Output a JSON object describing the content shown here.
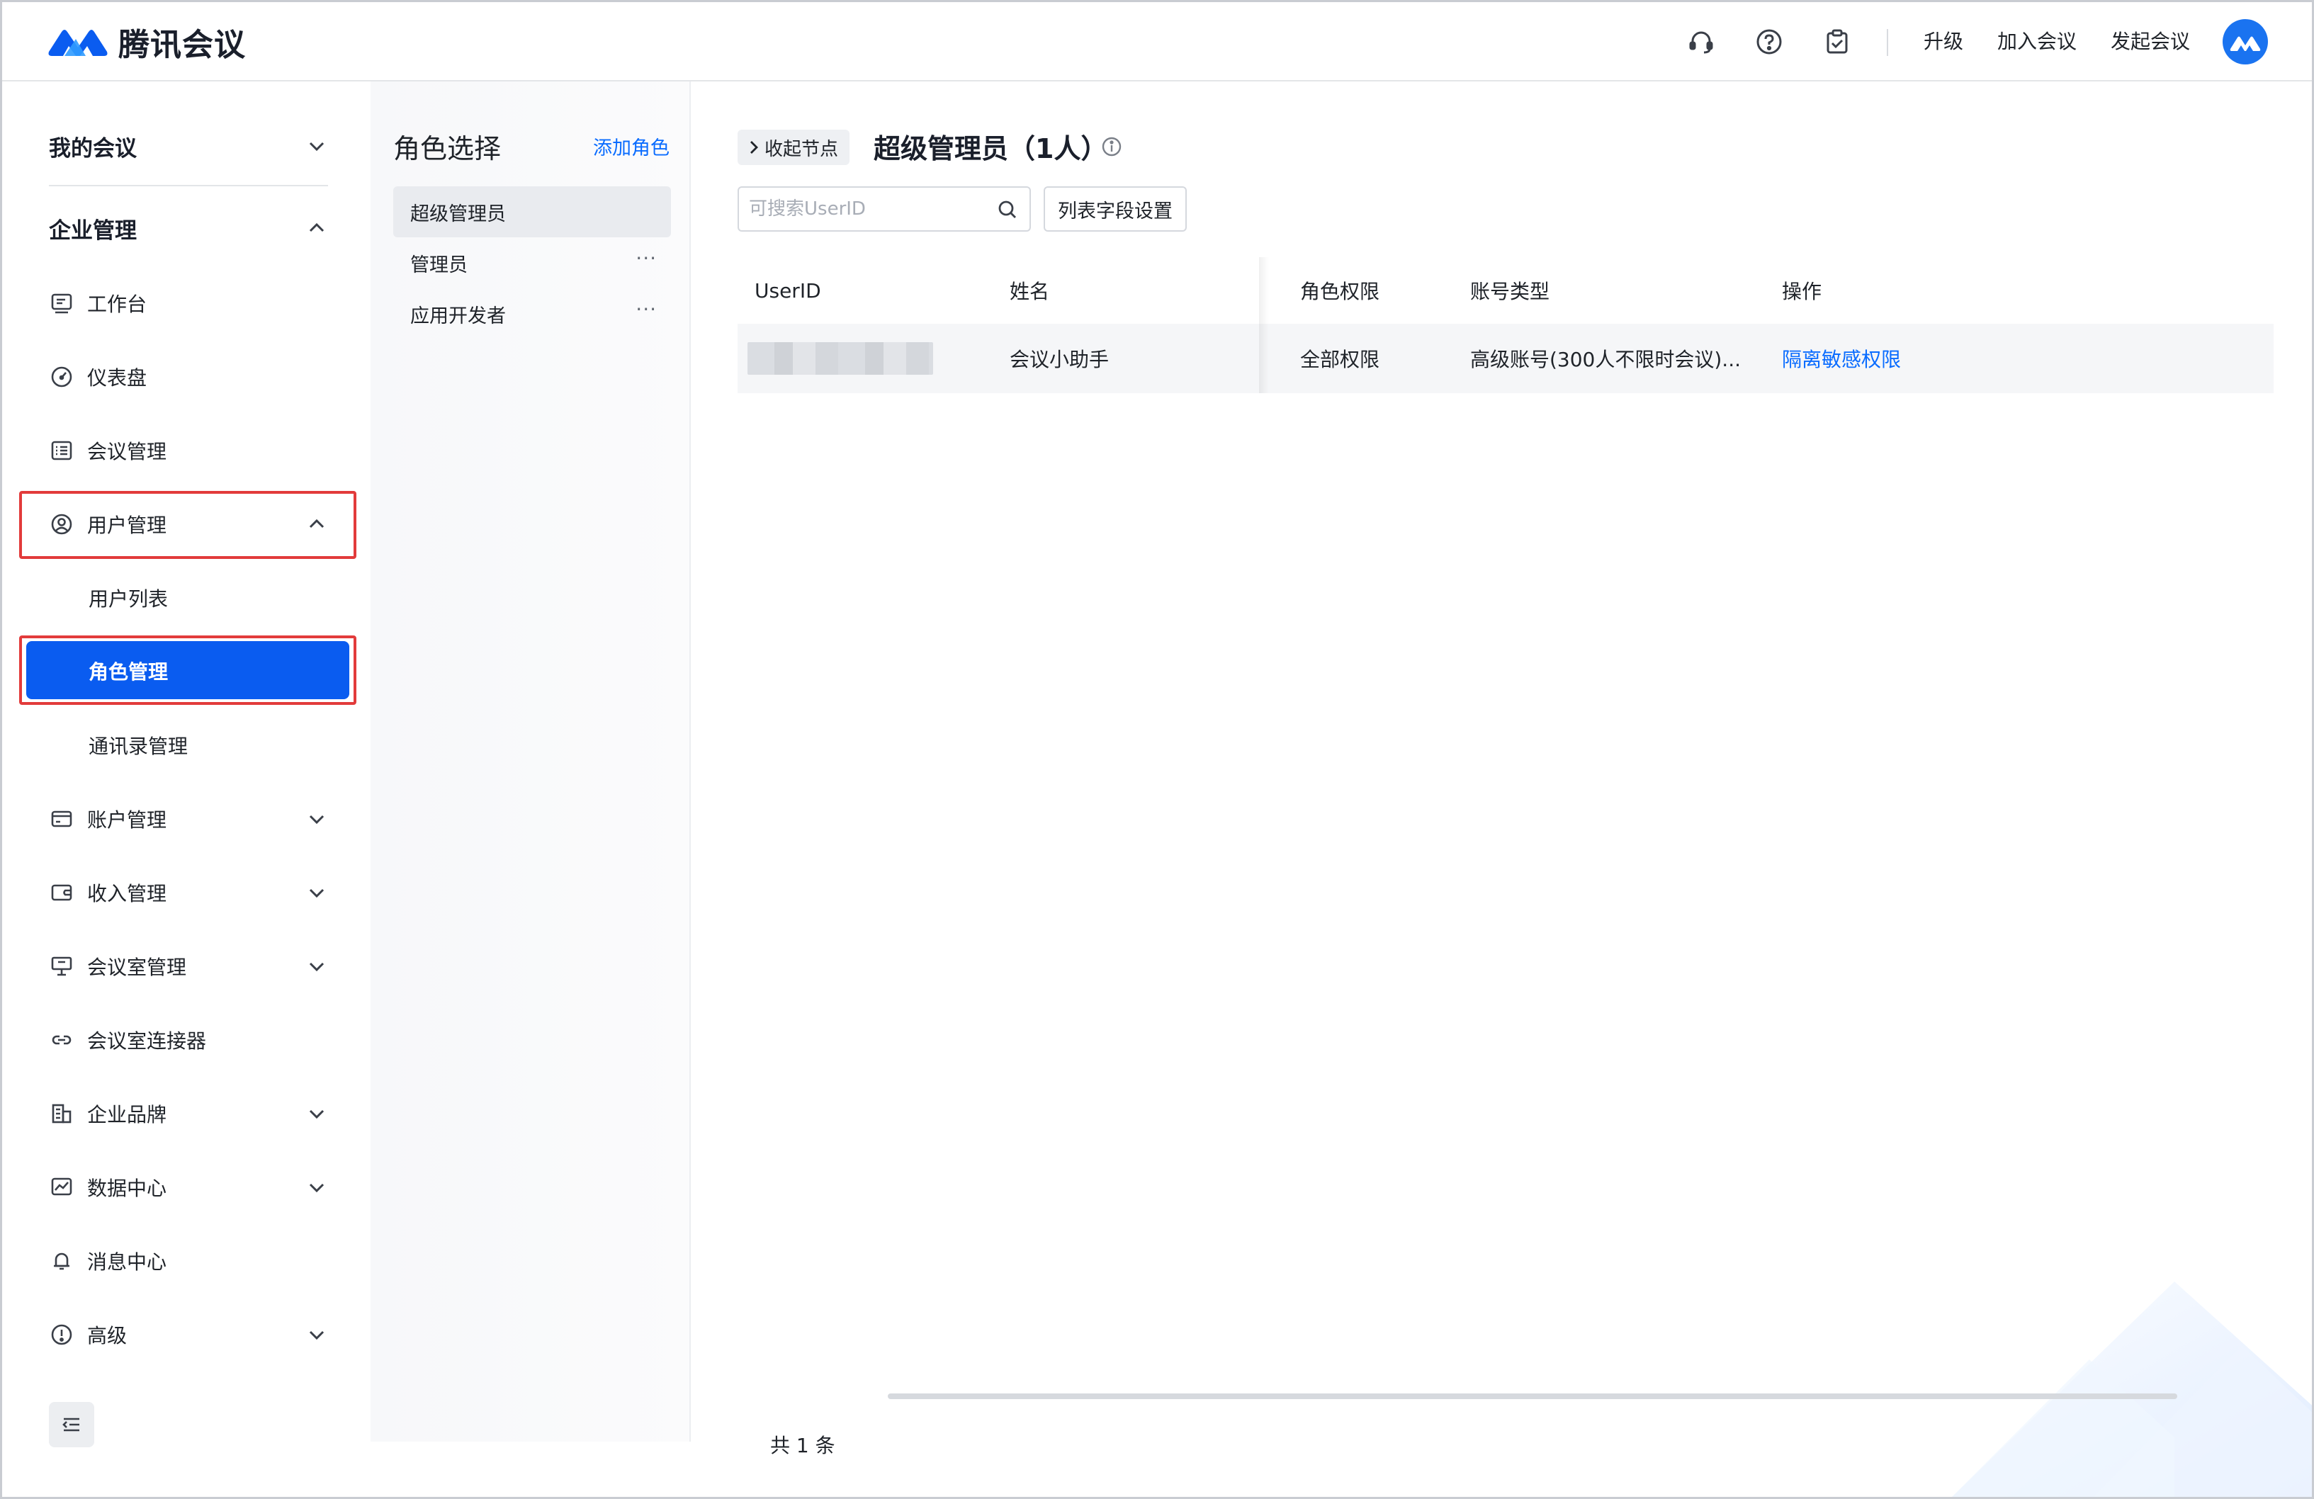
{
  "header": {
    "app_name": "腾讯会议",
    "icons": [
      "headset-icon",
      "help-icon",
      "task-icon"
    ],
    "links": {
      "upgrade": "升级",
      "join": "加入会议",
      "start": "发起会议"
    }
  },
  "sidebar": {
    "my_meetings": "我的会议",
    "enterprise": "企业管理",
    "items": {
      "workbench": "工作台",
      "dashboard": "仪表盘",
      "meeting_mgmt": "会议管理",
      "user_mgmt": "用户管理",
      "user_list": "用户列表",
      "role_mgmt": "角色管理",
      "contacts_mgmt": "通讯录管理",
      "account_mgmt": "账户管理",
      "income_mgmt": "收入管理",
      "room_mgmt": "会议室管理",
      "room_connector": "会议室连接器",
      "brand": "企业品牌",
      "data_center": "数据中心",
      "message_center": "消息中心",
      "advanced": "高级"
    }
  },
  "roles": {
    "title": "角色选择",
    "add_label": "添加角色",
    "items": [
      "超级管理员",
      "管理员",
      "应用开发者"
    ],
    "more_label": "···"
  },
  "main": {
    "collapse_label": "收起节点",
    "title": "超级管理员（1人）",
    "search_placeholder": "可搜索UserID",
    "field_settings": "列表字段设置",
    "columns": [
      "UserID",
      "姓名",
      "角色权限",
      "账号类型",
      "操作"
    ],
    "rows": [
      {
        "name": "会议小助手",
        "permission": "全部权限",
        "account_type": "高级账号(300人不限时会议)...",
        "action": "隔离敏感权限"
      }
    ],
    "total": "共 1 条"
  },
  "colors": {
    "accent": "#0a5cf0",
    "link": "#0a6cff",
    "highlight": "#e23b3b"
  }
}
